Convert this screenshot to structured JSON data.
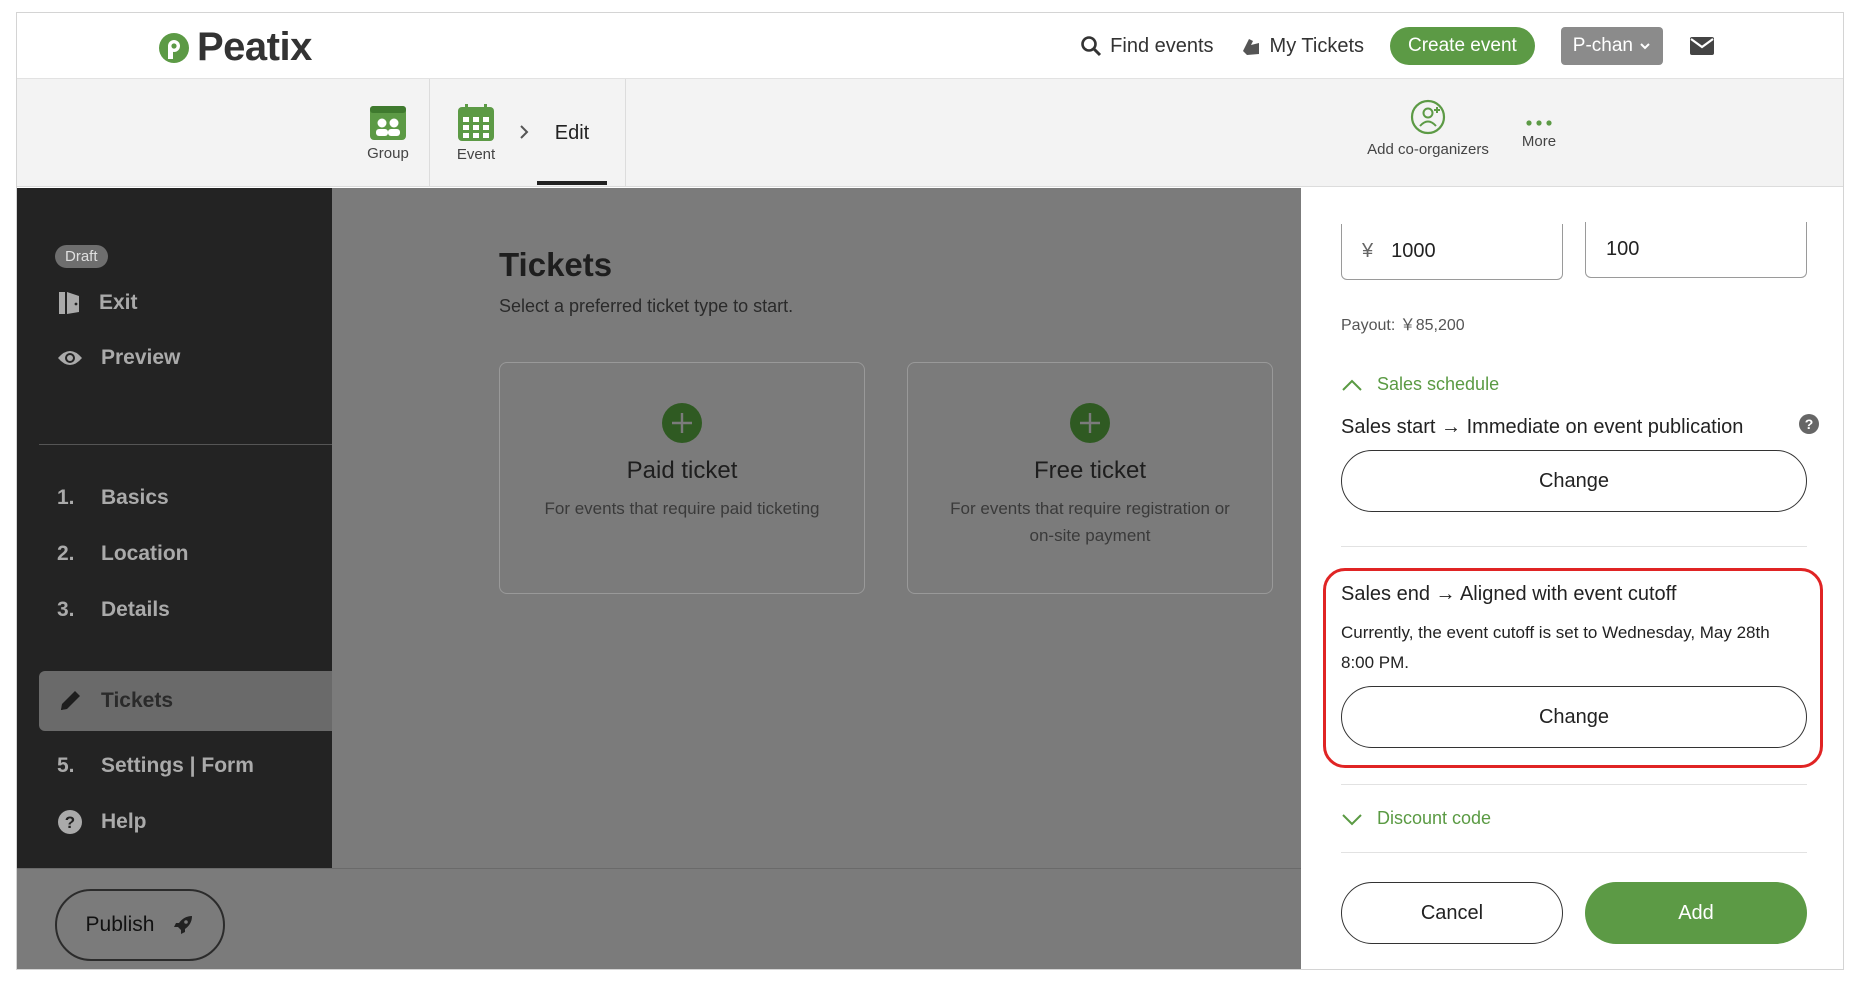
{
  "brand": {
    "name": "Peatix",
    "accent": "#5c9a45"
  },
  "topnav": {
    "find_events": "Find events",
    "my_tickets": "My Tickets",
    "create_event": "Create event",
    "user": "P-chan"
  },
  "subbar": {
    "group_label": "Group",
    "event_label": "Event",
    "edit_label": "Edit",
    "add_coorganizers": "Add co-organizers",
    "more": "More"
  },
  "sidebar": {
    "status_badge": "Draft",
    "exit": "Exit",
    "preview": "Preview",
    "steps": [
      {
        "num": "1.",
        "label": "Basics"
      },
      {
        "num": "2.",
        "label": "Location"
      },
      {
        "num": "3.",
        "label": "Details"
      },
      {
        "num": "",
        "label": "Tickets"
      },
      {
        "num": "5.",
        "label": "Settings | Form"
      }
    ],
    "help": "Help",
    "publish": "Publish"
  },
  "main": {
    "title": "Tickets",
    "subtitle": "Select a preferred ticket type to start.",
    "cards": [
      {
        "title": "Paid ticket",
        "desc": "For events that require paid ticketing"
      },
      {
        "title": "Free ticket",
        "desc": "For events that require registration or on-site payment"
      }
    ]
  },
  "panel": {
    "price_currency": "¥",
    "price_value": "1000",
    "quantity_value": "100",
    "payout": "Payout: ￥85,200",
    "sales_schedule_label": "Sales schedule",
    "sales_start": "Sales start → Immediate on event publication",
    "change_label": "Change",
    "sales_end": "Sales end → Aligned with event cutoff",
    "cutoff_text": "Currently, the event cutoff is set to Wednesday, May 28th 8:00 PM.",
    "discount_code_label": "Discount code",
    "cancel": "Cancel",
    "add": "Add"
  }
}
